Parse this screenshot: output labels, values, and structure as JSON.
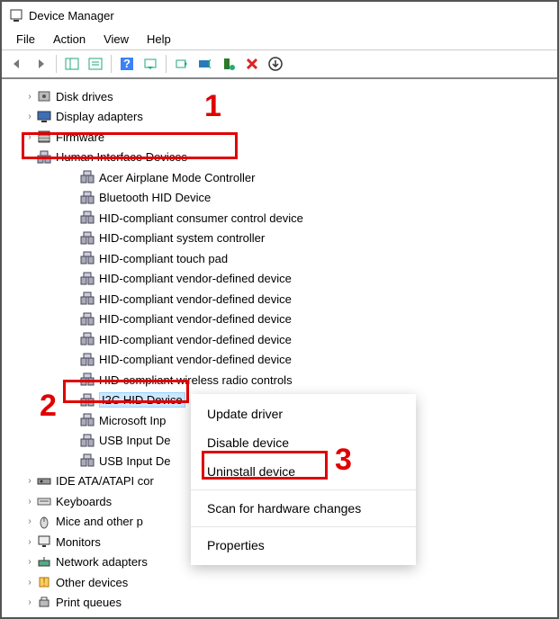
{
  "window": {
    "title": "Device Manager"
  },
  "menu": {
    "items": [
      "File",
      "Action",
      "View",
      "Help"
    ]
  },
  "tree": {
    "collapsed": [
      {
        "label": "Disk drives",
        "icon": "disk"
      },
      {
        "label": "Display adapters",
        "icon": "display"
      },
      {
        "label": "Firmware",
        "icon": "firmware"
      }
    ],
    "hid_category": {
      "label": "Human Interface Devices",
      "icon": "hid"
    },
    "hid_children": [
      "Acer Airplane Mode Controller",
      "Bluetooth HID Device",
      "HID-compliant consumer control device",
      "HID-compliant system controller",
      "HID-compliant touch pad",
      "HID-compliant vendor-defined device",
      "HID-compliant vendor-defined device",
      "HID-compliant vendor-defined device",
      "HID-compliant vendor-defined device",
      "HID-compliant vendor-defined device",
      "HID-compliant wireless radio controls",
      "I2C HID Device",
      "Microsoft Inp",
      "USB Input De",
      "USB Input De"
    ],
    "selected_index": 11,
    "collapsed_after": [
      {
        "label": "IDE ATA/ATAPI cor",
        "icon": "ide"
      },
      {
        "label": "Keyboards",
        "icon": "keyboard"
      },
      {
        "label": "Mice and other p",
        "icon": "mouse"
      },
      {
        "label": "Monitors",
        "icon": "monitor"
      },
      {
        "label": "Network adapters",
        "icon": "network"
      },
      {
        "label": "Other devices",
        "icon": "other"
      },
      {
        "label": "Print queues",
        "icon": "printer"
      }
    ]
  },
  "contextmenu": {
    "items": [
      "Update driver",
      "Disable device",
      "Uninstall device",
      "Scan for hardware changes",
      "Properties"
    ],
    "highlighted_index": 2
  },
  "annotations": {
    "step1": "1",
    "step2": "2",
    "step3": "3"
  }
}
